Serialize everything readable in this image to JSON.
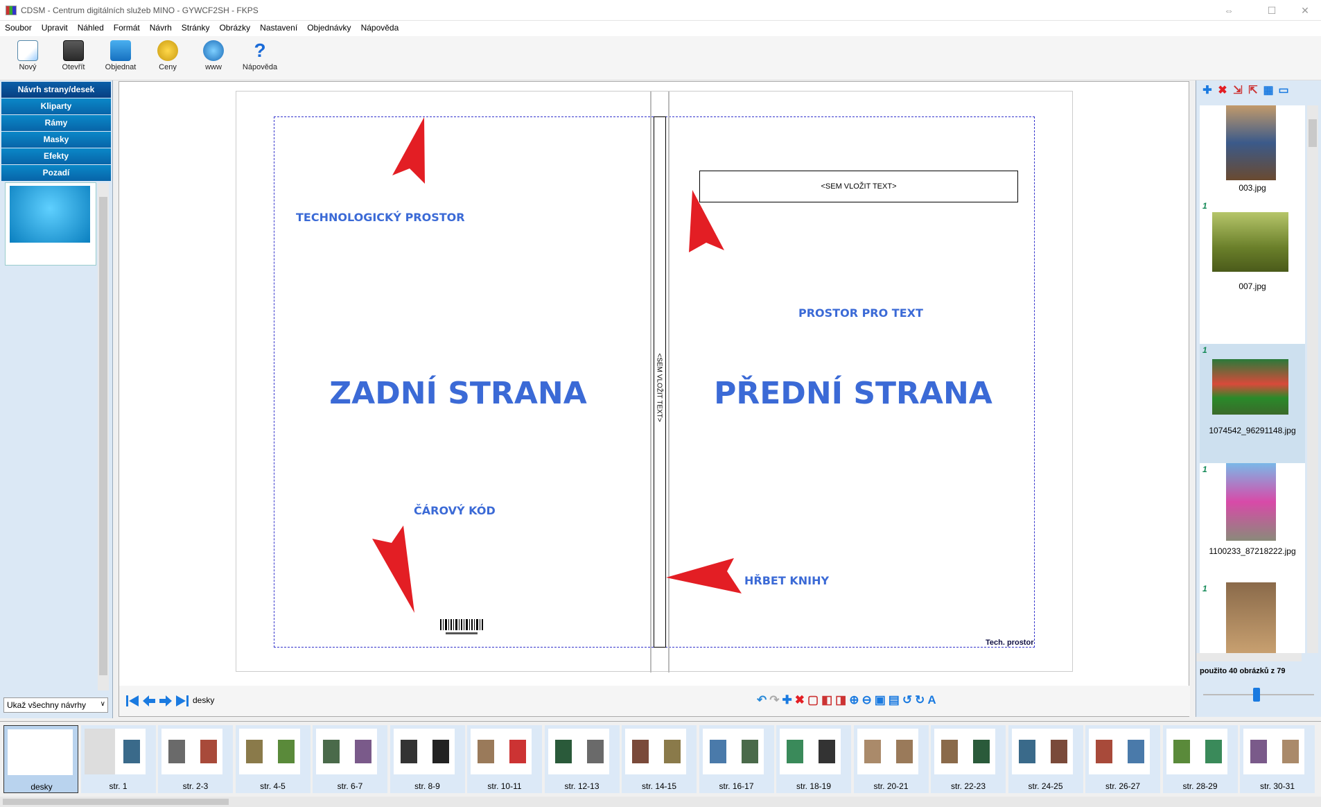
{
  "window": {
    "title": "CDSM - Centrum digitálních služeb MINO - GYWCF2SH - FKPS"
  },
  "menu": [
    "Soubor",
    "Upravit",
    "Náhled",
    "Formát",
    "Návrh",
    "Stránky",
    "Obrázky",
    "Nastavení",
    "Objednávky",
    "Nápověda"
  ],
  "toolbar": {
    "new": "Nový",
    "open": "Otevřít",
    "order": "Objednat",
    "prices": "Ceny",
    "www": "www",
    "help": "Nápověda"
  },
  "left": {
    "categories": [
      "Návrh strany/desek",
      "Kliparty",
      "Rámy",
      "Masky",
      "Efekty",
      "Pozadí"
    ],
    "show_all": "Ukaž všechny návrhy"
  },
  "canvas": {
    "back_title": "ZADNÍ STRANA",
    "front_title": "PŘEDNÍ STRANA",
    "tech_label": "TECHNOLOGICKÝ PROSTOR",
    "text_label": "PROSTOR PRO TEXT",
    "barcode_label": "ČÁROVÝ KÓD",
    "spine_label": "HŘBET KNIHY",
    "textbox_placeholder": "<SEM VLOŽIT TEXT>",
    "spine_placeholder": "<SEM VLOŽIT TEXT>",
    "tech_tag": "Tech. prostor",
    "current_page": "desky"
  },
  "images": [
    {
      "badge": "",
      "name": "003.jpg"
    },
    {
      "badge": "1",
      "name": "007.jpg"
    },
    {
      "badge": "1",
      "name": "1074542_96291148.jpg"
    },
    {
      "badge": "1",
      "name": "1100233_87218222.jpg"
    },
    {
      "badge": "1",
      "name": ""
    }
  ],
  "used_text": "použito 40 obrázků z  79",
  "spreads": [
    "desky",
    "str. 1",
    "str. 2-3",
    "str. 4-5",
    "str. 6-7",
    "str. 8-9",
    "str. 10-11",
    "str. 12-13",
    "str. 14-15",
    "str. 16-17",
    "str. 18-19",
    "str. 20-21",
    "str. 22-23",
    "str. 24-25",
    "str. 26-27",
    "str. 28-29",
    "str. 30-31"
  ],
  "colors": {
    "accent": "#3b6ad6",
    "category": "#0a88c8",
    "arrow": "#e31e24"
  }
}
